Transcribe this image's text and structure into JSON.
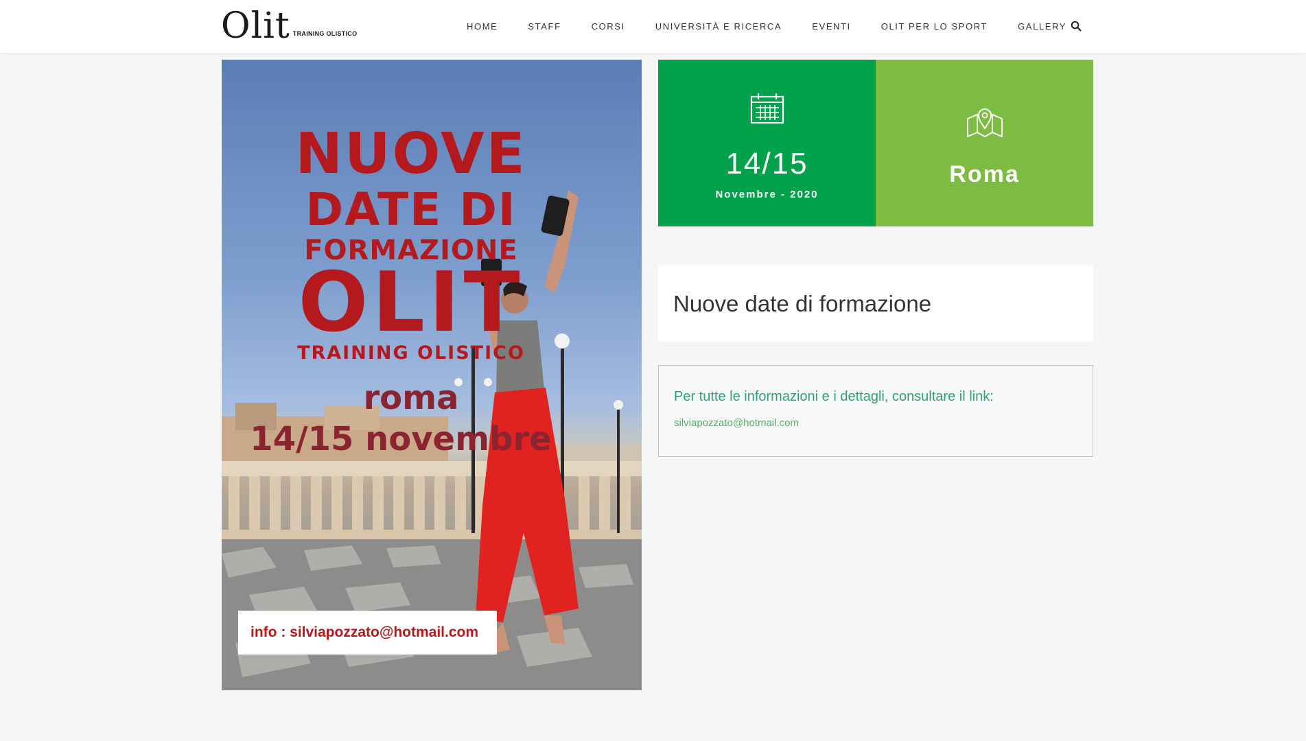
{
  "header": {
    "logo_mark": "Olit",
    "logo_sub": "TRAINING OLISTICO",
    "nav": [
      "HOME",
      "STAFF",
      "CORSI",
      "UNIVERSITÀ E RICERCA",
      "EVENTI",
      "OLIT PER LO SPORT",
      "GALLERY"
    ],
    "search_icon": "search-icon"
  },
  "poster": {
    "line1": "NUOVE",
    "line2": "DATE DI",
    "line3": "FORMAZIONE",
    "line4": "OLIT",
    "line5": "TRAINING OLISTICO",
    "line6": "roma",
    "line7": "14/15 novembre",
    "info": "info : silviapozzato@hotmail.com"
  },
  "event": {
    "date_big": "14/15",
    "date_small": "Novembre - 2020",
    "date_icon": "calendar-icon",
    "place": "Roma",
    "place_icon": "map-pin-icon",
    "title": "Nuove date di formazione",
    "info_text": "Per tutte le informazioni e i dettagli, consultare il link:",
    "info_link": "silviapozzato@hotmail.com"
  },
  "colors": {
    "green_dark": "#02a14b",
    "green_light": "#7dbb42",
    "poster_red": "#b3191d",
    "link_green": "#2fa36b"
  }
}
